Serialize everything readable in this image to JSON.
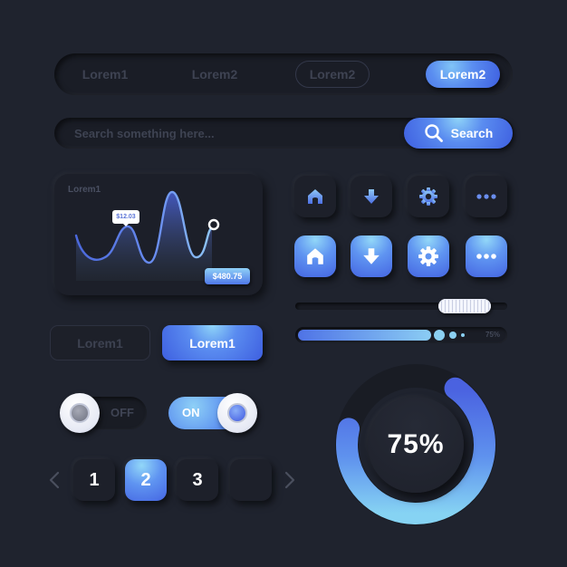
{
  "tabs": {
    "items": [
      {
        "label": "Lorem1",
        "state": "default"
      },
      {
        "label": "Lorem2",
        "state": "default"
      },
      {
        "label": "Lorem2",
        "state": "outlined"
      },
      {
        "label": "Lorem2",
        "state": "active"
      }
    ]
  },
  "search": {
    "placeholder": "Search something here...",
    "value": "",
    "button_label": "Search",
    "icon": "search-icon"
  },
  "chart_card": {
    "title": "Lorem1",
    "tooltip": "$12.03",
    "value_badge": "$480.75"
  },
  "icon_buttons": {
    "dark": [
      "home-icon",
      "download-arrow-icon",
      "gear-icon",
      "more-dots-icon"
    ],
    "light": [
      "home-icon",
      "download-arrow-icon",
      "gear-icon",
      "more-dots-icon"
    ]
  },
  "slider": {
    "value_fraction": 0.8
  },
  "progress": {
    "value_percent": 75,
    "label": "75%"
  },
  "buttons": {
    "ghost_label": "Lorem1",
    "primary_label": "Lorem1"
  },
  "toggles": {
    "off": {
      "label": "OFF",
      "state": false
    },
    "on": {
      "label": "ON",
      "state": true
    }
  },
  "pagination": {
    "pages": [
      "1",
      "2",
      "3",
      ""
    ],
    "active_index": 1,
    "prev_icon": "chevron-left-icon",
    "next_icon": "chevron-right-icon"
  },
  "donut": {
    "value_percent": 75,
    "label": "75%"
  },
  "colors": {
    "background": "#1f232e",
    "accent_light": "#8fd4f8",
    "accent": "#5a8cf0",
    "accent_dark": "#3e5fe0"
  }
}
